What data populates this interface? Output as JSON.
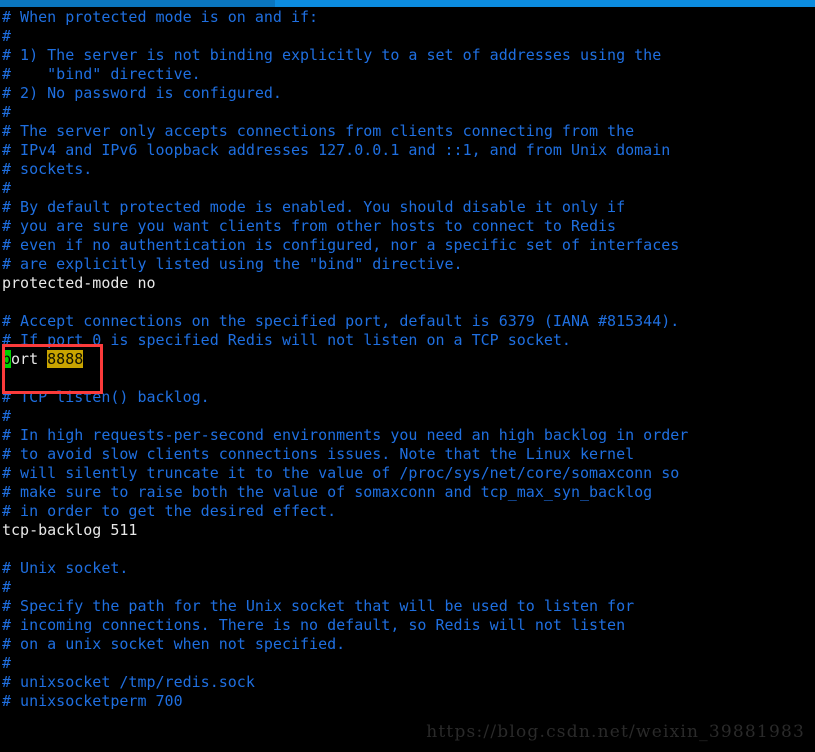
{
  "window": {
    "titlebar_color_left": "#0a76bf",
    "titlebar_color_right": "#0c8ce0"
  },
  "terminal": {
    "background": "#000000",
    "comment_color": "#1f6fe0",
    "code_color": "#e8e8e8",
    "cursor_color": "#00d000",
    "highlight_color": "#c9a400",
    "lines": [
      {
        "kind": "comment",
        "text": "# When protected mode is on and if:"
      },
      {
        "kind": "comment",
        "text": "#"
      },
      {
        "kind": "comment",
        "text": "# 1) The server is not binding explicitly to a set of addresses using the"
      },
      {
        "kind": "comment",
        "text": "#    \"bind\" directive."
      },
      {
        "kind": "comment",
        "text": "# 2) No password is configured."
      },
      {
        "kind": "comment",
        "text": "#"
      },
      {
        "kind": "comment",
        "text": "# The server only accepts connections from clients connecting from the"
      },
      {
        "kind": "comment",
        "text": "# IPv4 and IPv6 loopback addresses 127.0.0.1 and ::1, and from Unix domain"
      },
      {
        "kind": "comment",
        "text": "# sockets."
      },
      {
        "kind": "comment",
        "text": "#"
      },
      {
        "kind": "comment",
        "text": "# By default protected mode is enabled. You should disable it only if"
      },
      {
        "kind": "comment",
        "text": "# you are sure you want clients from other hosts to connect to Redis"
      },
      {
        "kind": "comment",
        "text": "# even if no authentication is configured, nor a specific set of interfaces"
      },
      {
        "kind": "comment",
        "text": "# are explicitly listed using the \"bind\" directive."
      },
      {
        "kind": "code",
        "text": "protected-mode no"
      },
      {
        "kind": "blank",
        "text": ""
      },
      {
        "kind": "comment",
        "text": "# Accept connections on the specified port, default is 6379 (IANA #815344)."
      },
      {
        "kind": "comment",
        "text": "# If port 0 is specified Redis will not listen on a TCP socket."
      },
      {
        "kind": "port-line",
        "text": "port 8888"
      },
      {
        "kind": "blank",
        "text": ""
      },
      {
        "kind": "comment",
        "text": "# TCP listen() backlog."
      },
      {
        "kind": "comment",
        "text": "#"
      },
      {
        "kind": "comment",
        "text": "# In high requests-per-second environments you need an high backlog in order"
      },
      {
        "kind": "comment",
        "text": "# to avoid slow clients connections issues. Note that the Linux kernel"
      },
      {
        "kind": "comment",
        "text": "# will silently truncate it to the value of /proc/sys/net/core/somaxconn so"
      },
      {
        "kind": "comment",
        "text": "# make sure to raise both the value of somaxconn and tcp_max_syn_backlog"
      },
      {
        "kind": "comment",
        "text": "# in order to get the desired effect."
      },
      {
        "kind": "code",
        "text": "tcp-backlog 511"
      },
      {
        "kind": "blank",
        "text": ""
      },
      {
        "kind": "comment",
        "text": "# Unix socket."
      },
      {
        "kind": "comment",
        "text": "#"
      },
      {
        "kind": "comment",
        "text": "# Specify the path for the Unix socket that will be used to listen for"
      },
      {
        "kind": "comment",
        "text": "# incoming connections. There is no default, so Redis will not listen"
      },
      {
        "kind": "comment",
        "text": "# on a unix socket when not specified."
      },
      {
        "kind": "comment",
        "text": "#"
      },
      {
        "kind": "comment",
        "text": "# unixsocket /tmp/redis.sock"
      },
      {
        "kind": "comment",
        "text": "# unixsocketperm 700"
      }
    ],
    "port_line": {
      "cursor_char": "p",
      "directive_rest": "ort",
      "space": " ",
      "value": "8888"
    }
  },
  "annotation": {
    "box_color": "#fb3b3b",
    "box_label": "port-8888-highlight"
  },
  "watermark": {
    "text": "https://blog.csdn.net/weixin_39881983",
    "color": "#2a2a2a"
  }
}
